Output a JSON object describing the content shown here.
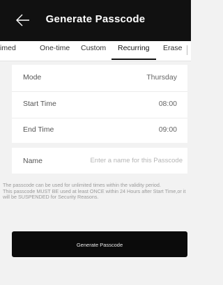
{
  "header": {
    "title": "Generate Passcode",
    "back_icon": "arrow-left-icon"
  },
  "tabs": [
    {
      "label": "Timed"
    },
    {
      "label": "One-time"
    },
    {
      "label": "Custom"
    },
    {
      "label": "Recurring",
      "active": true
    },
    {
      "label": "Erase"
    }
  ],
  "form": {
    "mode": {
      "label": "Mode",
      "value": "Thursday"
    },
    "start_time": {
      "label": "Start Time",
      "value": "08:00"
    },
    "end_time": {
      "label": "End Time",
      "value": "09:00"
    },
    "name": {
      "label": "Name",
      "placeholder": "Enter a name for this Passcode"
    }
  },
  "notice": {
    "line1": "The passcode can be used for unlimited times within the validity period.",
    "line2": "This passcode MUST BE used at least ONCE within 24 Hours after Start Time,or it will be SUSPENDED for Security Reasons."
  },
  "button": {
    "label": "Generate Passcode"
  },
  "colors": {
    "header_bg": "#111111",
    "button_bg": "#0b0b0b",
    "page_bg": "#f2f2f2"
  }
}
